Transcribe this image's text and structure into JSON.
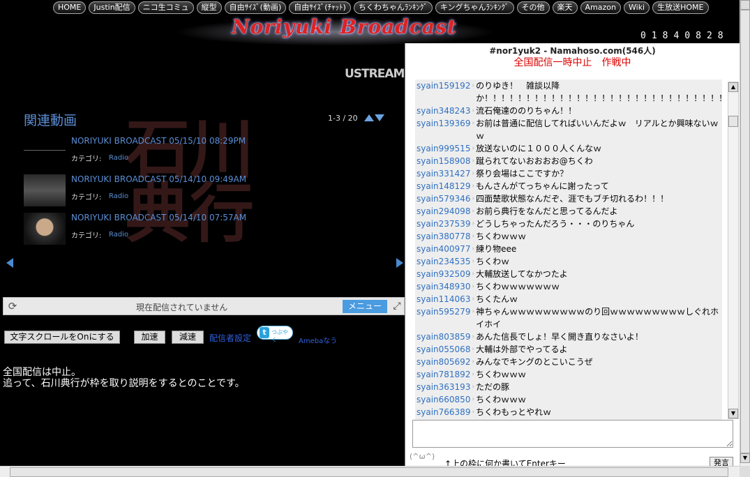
{
  "nav": [
    "HOME",
    "Justin配信",
    "ニコ生コミュ",
    "縦型",
    "自由ｻｲｽﾞ(動画)",
    "自由ｻｲｽﾞ(ﾁｬｯﾄ)",
    "ちくわちゃんﾗﾝｷﾝｸﾞ",
    "キングちゃんﾗﾝｷﾝｸﾞ",
    "その他",
    "楽天",
    "Amazon",
    "Wiki",
    "生放送HOME"
  ],
  "header": {
    "logo": "Noriyuki Broadcast",
    "counter": "01840828",
    "ustream": "USTREAM"
  },
  "related": {
    "title": "関連動画",
    "pager": "1-3 / 20",
    "category_label": "カテゴリ:",
    "videos": [
      {
        "title": "NORIYUKI BROADCAST 05/15/10 08:29PM",
        "category": "Radio"
      },
      {
        "title": "NORIYUKI BROADCAST 05/14/10 09:49AM",
        "category": "Radio"
      },
      {
        "title": "NORIYUKI BROADCAST 05/14/10 07:57AM",
        "category": "Radio"
      }
    ]
  },
  "watermark": "石川典行",
  "status": {
    "text": "現在配信されていません",
    "menu": "メニュー"
  },
  "controls": {
    "scroll": "文字スクロールをOnにする",
    "speedup": "加速",
    "slowdown": "減速",
    "settings": "配信者設定",
    "tweet": "つぶやく",
    "ameba": "Amebaなう"
  },
  "notice": [
    "全国配信は中止。",
    "追って、石川典行が枠を取り説明をするとのことです。"
  ],
  "chat": {
    "title": "#nor1yuk2 - Namahoso.com(546人)",
    "subtitle": "全国配信一時中止　作戦中",
    "hint": "↑上の枠に何か書いてEnterキー",
    "send": "発言",
    "messages": [
      {
        "user": "syain159192",
        "text": "のりゆき！　雑談以降か！！！！！！！！！！！！！！！！！！！！！！！！！！！！！！！"
      },
      {
        "user": "syain348243",
        "text": "流石俺達ののりちゃん！！"
      },
      {
        "user": "syain139369",
        "text": "お前は普通に配信してればいいんだよｗ　リアルとか興味ないｗｗ"
      },
      {
        "user": "syain999515",
        "text": "放送ないのに１０００人くんなｗ"
      },
      {
        "user": "syain158908",
        "text": "蹴られてないおおおお@ちくわ"
      },
      {
        "user": "syain331427",
        "text": "祭り会場はここですか？"
      },
      {
        "user": "syain148129",
        "text": "もんさんがてっちゃんに謝ったって"
      },
      {
        "user": "syain579346",
        "text": "四面楚歌状態なんだぞ、涯でもブチ切れるわ！！！"
      },
      {
        "user": "syain294098",
        "text": "お前ら典行をなんだと思ってるんだよ"
      },
      {
        "user": "syain237539",
        "text": "どうしちゃったんだろう・・・のりちゃん"
      },
      {
        "user": "syain380778",
        "text": "ちくわｗｗｗ"
      },
      {
        "user": "syain400977",
        "text": "練り物eee"
      },
      {
        "user": "syain234535",
        "text": "ちくわｗ"
      },
      {
        "user": "syain932509",
        "text": "大輔放送してなかつたよ"
      },
      {
        "user": "syain348930",
        "text": "ちくわｗｗｗｗｗｗｗ"
      },
      {
        "user": "syain114063",
        "text": "ちくたんｗ"
      },
      {
        "user": "syain595279",
        "text": "神ちゃんｗｗｗｗｗｗｗｗｗのり回ｗｗｗｗｗｗｗｗｗしぐれホイホイ"
      },
      {
        "user": "syain803859",
        "text": "あんた信長でしょ！早く開き直りなさいよ！"
      },
      {
        "user": "syain055068",
        "text": "大輔は外部でやってるよ"
      },
      {
        "user": "syain805692",
        "text": "みんなでキングのとこいこうぜ"
      },
      {
        "user": "syain781892",
        "text": "ちくわｗｗｗ"
      },
      {
        "user": "syain363193",
        "text": "ただの豚"
      },
      {
        "user": "syain660850",
        "text": "ちくわｗｗｗ"
      },
      {
        "user": "syain766389",
        "text": "ちくわもっとやれｗ"
      }
    ]
  }
}
